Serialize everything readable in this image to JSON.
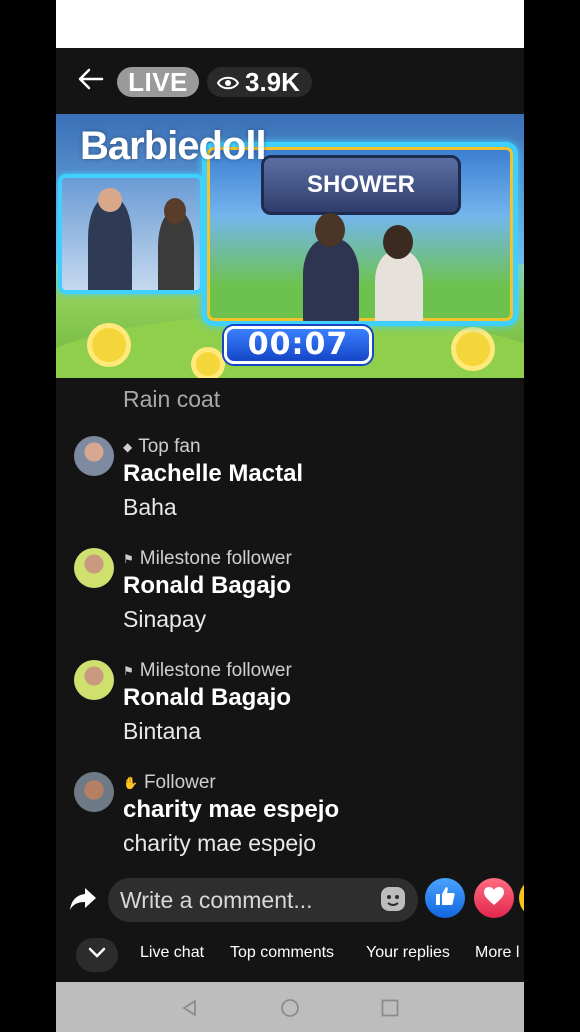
{
  "header": {
    "live_label": "LIVE",
    "viewer_count": "3.9K"
  },
  "video": {
    "streamer_name": "Barbiedoll",
    "sign_text": "SHOWER",
    "timer": "00:07"
  },
  "chat": {
    "partial_text": "Rain coat",
    "comments": [
      {
        "badge": "Top fan",
        "badge_icon": "diamond-icon",
        "name": "Rachelle Mactal",
        "text": "Baha"
      },
      {
        "badge": "Milestone follower",
        "badge_icon": "flag-icon",
        "name": "Ronald Bagajo",
        "text": "Sinapay"
      },
      {
        "badge": "Milestone follower",
        "badge_icon": "flag-icon",
        "name": "Ronald Bagajo",
        "text": "Bintana"
      },
      {
        "badge": "Follower",
        "badge_icon": "wave-hand-icon",
        "name": "charity mae espejo",
        "text": "charity mae espejo"
      }
    ]
  },
  "composer": {
    "placeholder": "Write a comment..."
  },
  "tabs": {
    "live_chat": "Live chat",
    "top_comments": "Top comments",
    "your_replies": "Your replies",
    "more": "More l"
  },
  "colors": {
    "background": "#141414",
    "like_blue": "#1877f2",
    "love_red": "#e2264d",
    "timer_blue": "#1446c7"
  }
}
